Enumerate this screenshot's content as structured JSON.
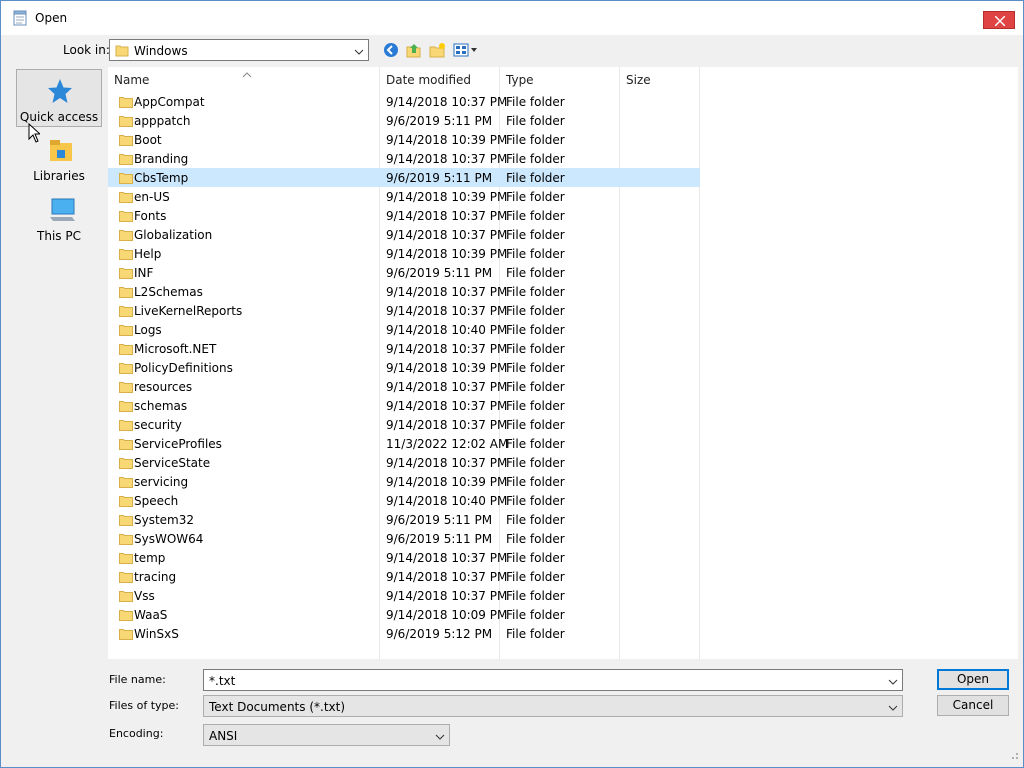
{
  "window": {
    "title": "Open",
    "close_icon": "close-icon"
  },
  "toolbar": {
    "look_in_label": "Look in:",
    "look_in_value": "Windows",
    "icons": [
      "back-icon",
      "up-folder-icon",
      "new-folder-icon",
      "view-menu-icon"
    ]
  },
  "places": [
    {
      "label": "Quick access",
      "icon": "star-icon"
    },
    {
      "label": "Libraries",
      "icon": "libraries-icon"
    },
    {
      "label": "This PC",
      "icon": "computer-icon"
    }
  ],
  "columns": {
    "name": "Name",
    "date": "Date modified",
    "type": "Type",
    "size": "Size"
  },
  "files": [
    {
      "name": "AppCompat",
      "date": "9/14/2018 10:37 PM",
      "type": "File folder"
    },
    {
      "name": "apppatch",
      "date": "9/6/2019 5:11 PM",
      "type": "File folder"
    },
    {
      "name": "Boot",
      "date": "9/14/2018 10:39 PM",
      "type": "File folder"
    },
    {
      "name": "Branding",
      "date": "9/14/2018 10:37 PM",
      "type": "File folder"
    },
    {
      "name": "CbsTemp",
      "date": "9/6/2019 5:11 PM",
      "type": "File folder",
      "selected": true
    },
    {
      "name": "en-US",
      "date": "9/14/2018 10:39 PM",
      "type": "File folder"
    },
    {
      "name": "Fonts",
      "date": "9/14/2018 10:37 PM",
      "type": "File folder"
    },
    {
      "name": "Globalization",
      "date": "9/14/2018 10:37 PM",
      "type": "File folder"
    },
    {
      "name": "Help",
      "date": "9/14/2018 10:39 PM",
      "type": "File folder"
    },
    {
      "name": "INF",
      "date": "9/6/2019 5:11 PM",
      "type": "File folder"
    },
    {
      "name": "L2Schemas",
      "date": "9/14/2018 10:37 PM",
      "type": "File folder"
    },
    {
      "name": "LiveKernelReports",
      "date": "9/14/2018 10:37 PM",
      "type": "File folder"
    },
    {
      "name": "Logs",
      "date": "9/14/2018 10:40 PM",
      "type": "File folder"
    },
    {
      "name": "Microsoft.NET",
      "date": "9/14/2018 10:37 PM",
      "type": "File folder"
    },
    {
      "name": "PolicyDefinitions",
      "date": "9/14/2018 10:39 PM",
      "type": "File folder"
    },
    {
      "name": "resources",
      "date": "9/14/2018 10:37 PM",
      "type": "File folder"
    },
    {
      "name": "schemas",
      "date": "9/14/2018 10:37 PM",
      "type": "File folder"
    },
    {
      "name": "security",
      "date": "9/14/2018 10:37 PM",
      "type": "File folder"
    },
    {
      "name": "ServiceProfiles",
      "date": "11/3/2022 12:02 AM",
      "type": "File folder"
    },
    {
      "name": "ServiceState",
      "date": "9/14/2018 10:37 PM",
      "type": "File folder"
    },
    {
      "name": "servicing",
      "date": "9/14/2018 10:39 PM",
      "type": "File folder"
    },
    {
      "name": "Speech",
      "date": "9/14/2018 10:40 PM",
      "type": "File folder"
    },
    {
      "name": "System32",
      "date": "9/6/2019 5:11 PM",
      "type": "File folder"
    },
    {
      "name": "SysWOW64",
      "date": "9/6/2019 5:11 PM",
      "type": "File folder"
    },
    {
      "name": "temp",
      "date": "9/14/2018 10:37 PM",
      "type": "File folder"
    },
    {
      "name": "tracing",
      "date": "9/14/2018 10:37 PM",
      "type": "File folder"
    },
    {
      "name": "Vss",
      "date": "9/14/2018 10:37 PM",
      "type": "File folder"
    },
    {
      "name": "WaaS",
      "date": "9/14/2018 10:09 PM",
      "type": "File folder"
    },
    {
      "name": "WinSxS",
      "date": "9/6/2019 5:12 PM",
      "type": "File folder"
    }
  ],
  "bottom": {
    "file_name_label": "File name:",
    "file_name_value": "*.txt",
    "file_type_label": "Files of type:",
    "file_type_value": "Text Documents (*.txt)",
    "encoding_label": "Encoding:",
    "encoding_value": "ANSI",
    "open_label": "Open",
    "cancel_label": "Cancel"
  },
  "colors": {
    "selection": "#cce8ff",
    "close_red": "#e04343",
    "folder_yellow": "#f8d775",
    "accent": "#0078d7"
  }
}
